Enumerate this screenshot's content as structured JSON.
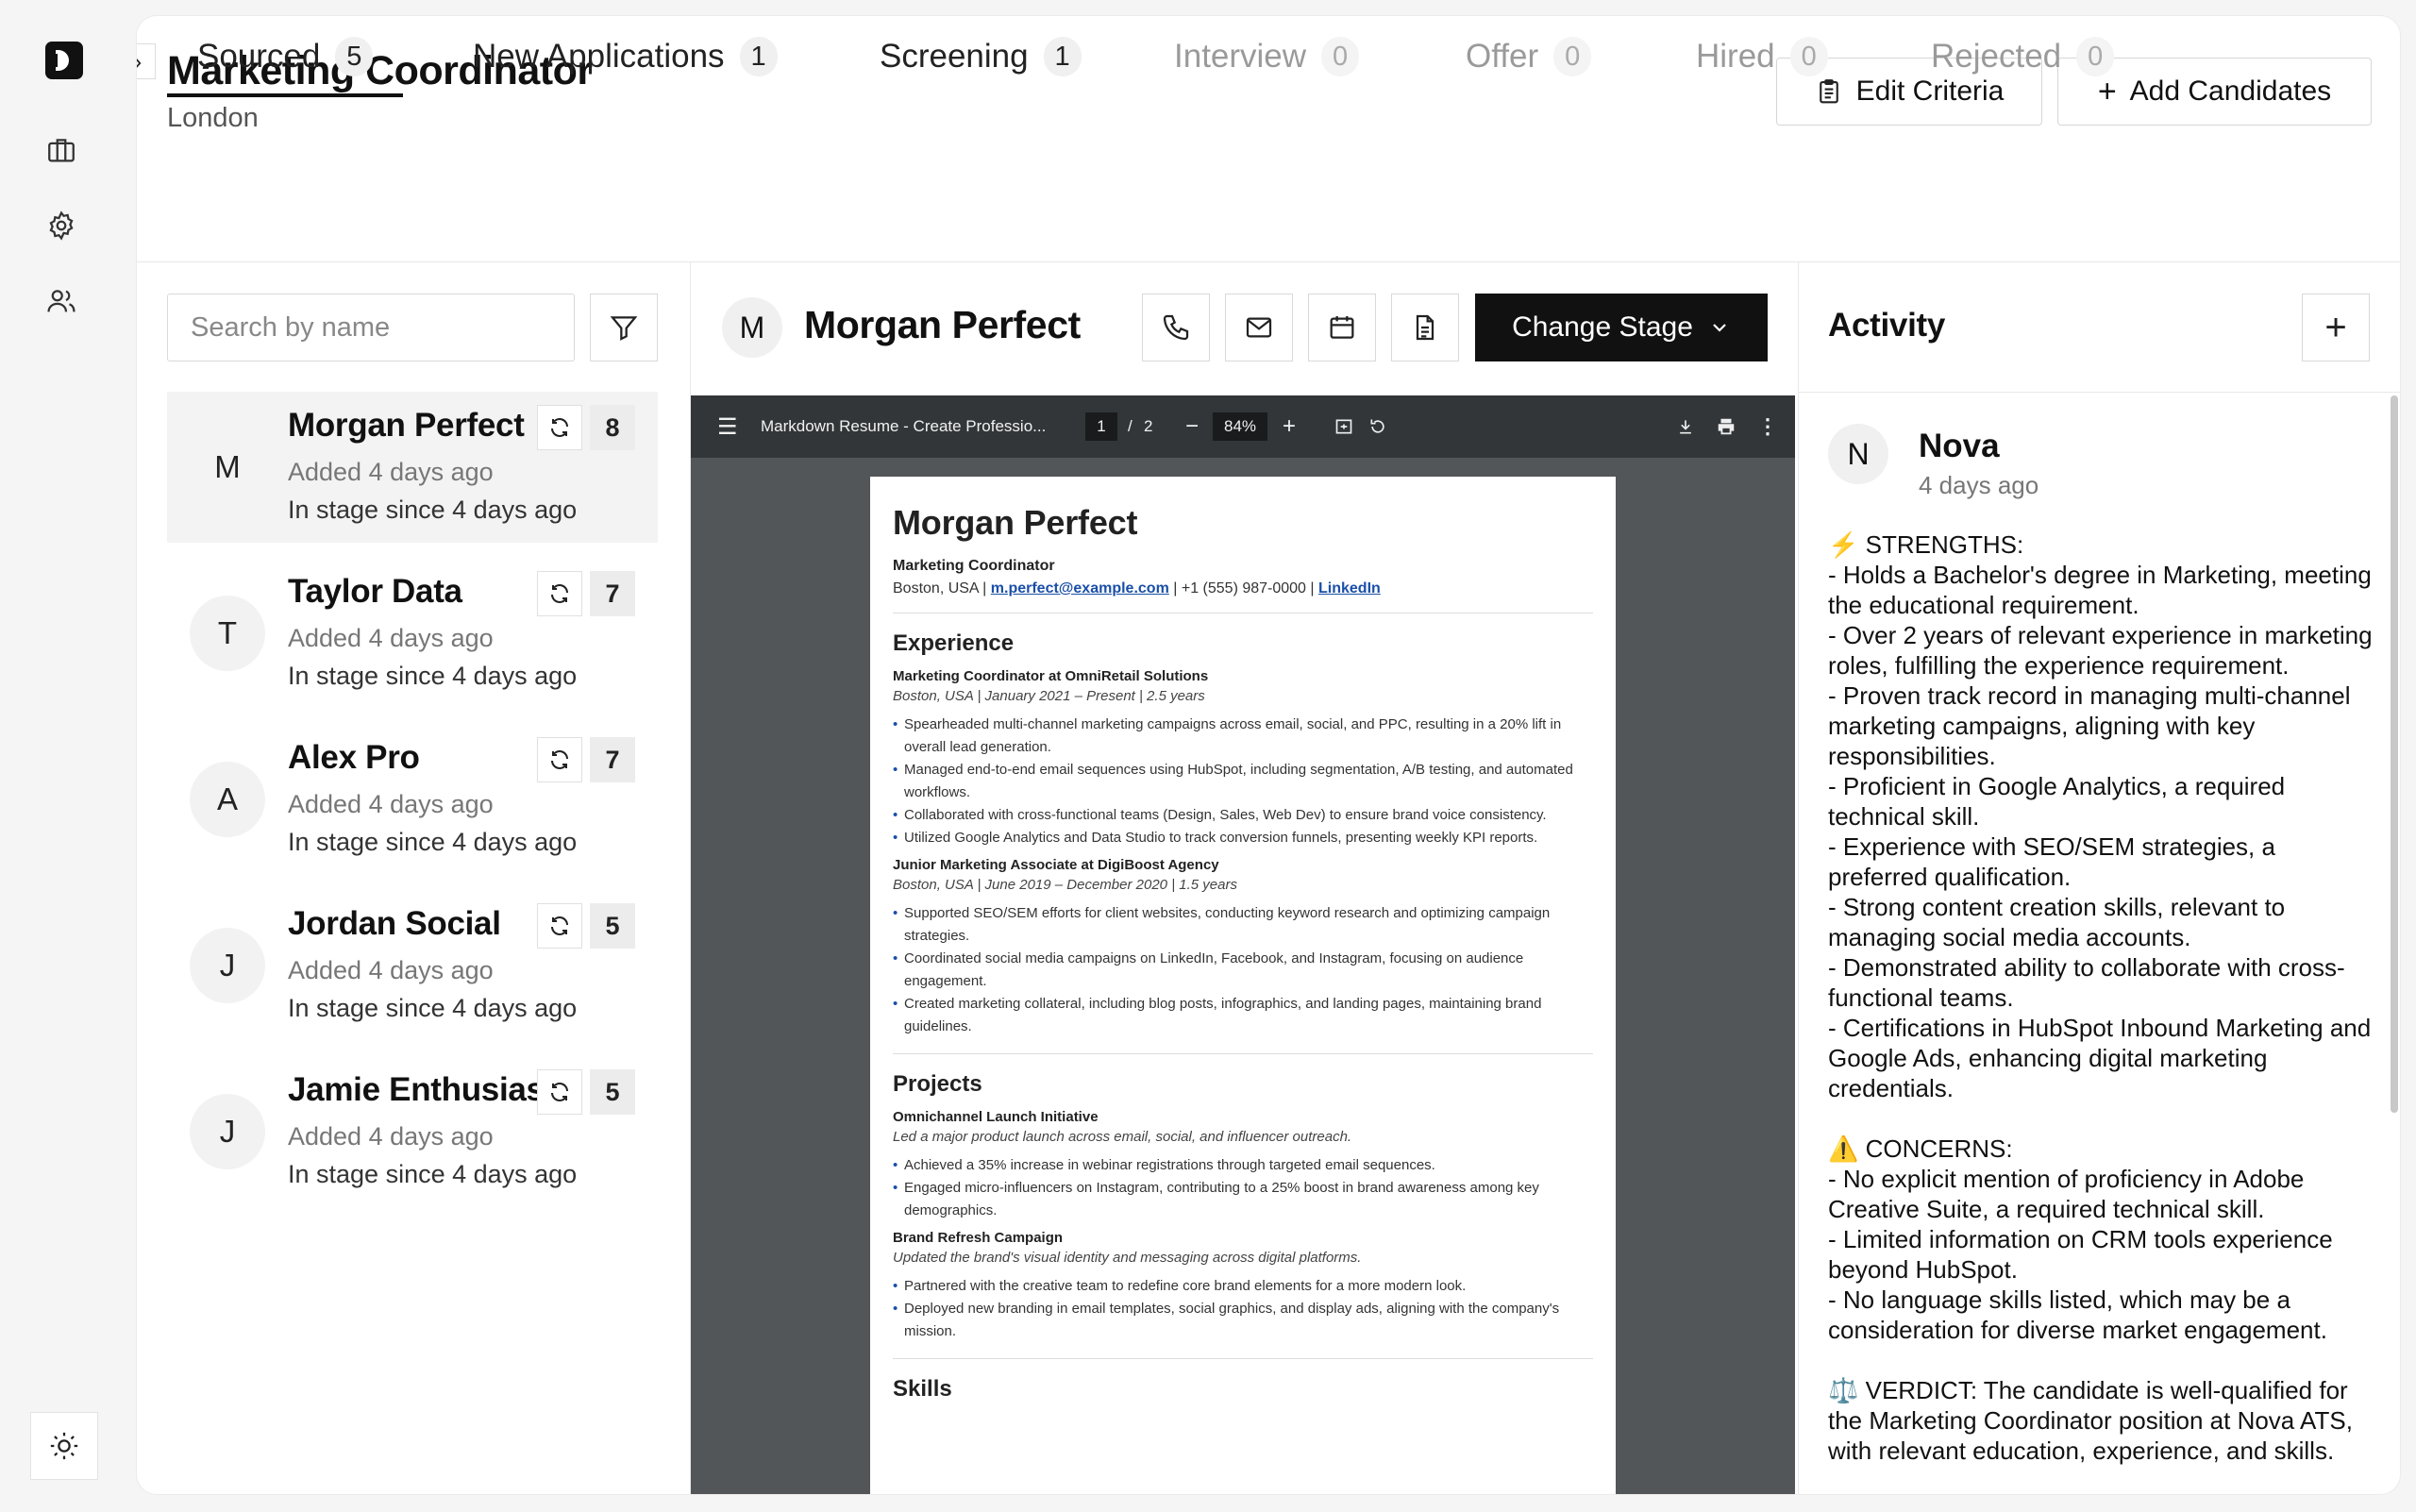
{
  "job": {
    "title": "Marketing Coordinator",
    "location": "London",
    "edit_label": "Edit Criteria",
    "add_label": "Add Candidates"
  },
  "tabs": [
    {
      "label": "Sourced",
      "count": "5"
    },
    {
      "label": "New Applications",
      "count": "1"
    },
    {
      "label": "Screening",
      "count": "1"
    },
    {
      "label": "Interview",
      "count": "0"
    },
    {
      "label": "Offer",
      "count": "0"
    },
    {
      "label": "Hired",
      "count": "0"
    },
    {
      "label": "Rejected",
      "count": "0"
    }
  ],
  "search": {
    "placeholder": "Search by name"
  },
  "candidates": [
    {
      "initial": "M",
      "name": "Morgan Perfect",
      "added": "Added 4 days ago",
      "stage": "In stage since 4 days ago",
      "score": "8"
    },
    {
      "initial": "T",
      "name": "Taylor Data",
      "added": "Added 4 days ago",
      "stage": "In stage since 4 days ago",
      "score": "7"
    },
    {
      "initial": "A",
      "name": "Alex Pro",
      "added": "Added 4 days ago",
      "stage": "In stage since 4 days ago",
      "score": "7"
    },
    {
      "initial": "J",
      "name": "Jordan Social",
      "added": "Added 4 days ago",
      "stage": "In stage since 4 days ago",
      "score": "5"
    },
    {
      "initial": "J",
      "name": "Jamie Enthusiast",
      "added": "Added 4 days ago",
      "stage": "In stage since 4 days ago",
      "score": "5"
    }
  ],
  "selected": {
    "initial": "M",
    "name": "Morgan Perfect",
    "change_stage_label": "Change Stage"
  },
  "pdf": {
    "title": "Markdown Resume - Create Professio...",
    "page": "1",
    "separator": "/",
    "pages": "2",
    "zoom": "84%"
  },
  "resume": {
    "name": "Morgan Perfect",
    "role": "Marketing Coordinator",
    "location": "Boston, USA |",
    "email": "m.perfect@example.com",
    "phone": "| +1 (555) 987-0000 |",
    "linkedin": "LinkedIn",
    "experience_heading": "Experience",
    "job1_title": "Marketing Coordinator at OmniRetail Solutions",
    "job1_meta": "Boston, USA | January 2021 – Present | 2.5 years",
    "job1_bullets": [
      "Spearheaded multi-channel marketing campaigns across email, social, and PPC, resulting in a 20% lift in overall lead generation.",
      "Managed end-to-end email sequences using HubSpot, including segmentation, A/B testing, and automated workflows.",
      "Collaborated with cross-functional teams (Design, Sales, Web Dev) to ensure brand voice consistency.",
      "Utilized Google Analytics and Data Studio to track conversion funnels, presenting weekly KPI reports."
    ],
    "job2_title": "Junior Marketing Associate at DigiBoost Agency",
    "job2_meta": "Boston, USA | June 2019 – December 2020 | 1.5 years",
    "job2_bullets": [
      "Supported SEO/SEM efforts for client websites, conducting keyword research and optimizing campaign strategies.",
      "Coordinated social media campaigns on LinkedIn, Facebook, and Instagram, focusing on audience engagement.",
      "Created marketing collateral, including blog posts, infographics, and landing pages, maintaining brand guidelines."
    ],
    "projects_heading": "Projects",
    "proj1_title": "Omnichannel Launch Initiative",
    "proj1_meta": "Led a major product launch across email, social, and influencer outreach.",
    "proj1_bullets": [
      "Achieved a 35% increase in webinar registrations through targeted email sequences.",
      "Engaged micro-influencers on Instagram, contributing to a 25% boost in brand awareness among key demographics."
    ],
    "proj2_title": "Brand Refresh Campaign",
    "proj2_meta": "Updated the brand's visual identity and messaging across digital platforms.",
    "proj2_bullets": [
      "Partnered with the creative team to redefine core brand elements for a more modern look.",
      "Deployed new branding in email templates, social graphics, and display ads, aligning with the company's mission."
    ],
    "skills_heading": "Skills"
  },
  "activity": {
    "title": "Activity",
    "author_initial": "N",
    "author": "Nova",
    "time": "4 days ago",
    "body": "⚡ STRENGTHS:\n- Holds a Bachelor's degree in Marketing, meeting the educational requirement.\n- Over 2 years of relevant experience in marketing roles, fulfilling the experience requirement.\n- Proven track record in managing multi-channel marketing campaigns, aligning with key responsibilities.\n- Proficient in Google Analytics, a required technical skill.\n- Experience with SEO/SEM strategies, a preferred qualification.\n- Strong content creation skills, relevant to managing social media accounts.\n- Demonstrated ability to collaborate with cross-functional teams.\n- Certifications in HubSpot Inbound Marketing and Google Ads, enhancing digital marketing credentials.\n\n⚠️ CONCERNS:\n- No explicit mention of proficiency in Adobe Creative Suite, a required technical skill.\n- Limited information on CRM tools experience beyond HubSpot.\n- No language skills listed, which may be a consideration for diverse market engagement.\n\n⚖️ VERDICT: The candidate is well-qualified for the Marketing Coordinator position at Nova ATS, with relevant education, experience, and skills."
  }
}
